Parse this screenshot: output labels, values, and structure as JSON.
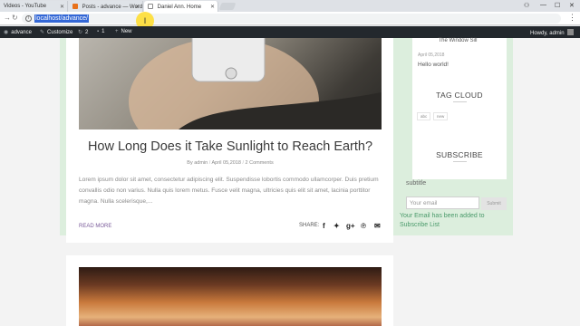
{
  "browser": {
    "tabs": [
      {
        "title": "Videos - YouTube",
        "favicon": "youtube-icon",
        "active": false
      },
      {
        "title": "Posts - advance — Word",
        "favicon": "wordpress-icon",
        "active": false
      },
      {
        "title": "Daniel Ann. Home",
        "favicon": "page-icon",
        "active": true
      }
    ],
    "url": "localhost/advance/",
    "cursor_label": "I"
  },
  "adminbar": {
    "site_name": "advance",
    "customize": "Customize",
    "updates_count": "2",
    "comments_count": "1",
    "new_label": "New",
    "howdy": "Howdy, admin"
  },
  "post": {
    "title": "How Long Does it Take Sunlight to Reach Earth?",
    "meta_by": "By",
    "author": "admin",
    "date": "April 05,2018",
    "comments": "2 Comments",
    "excerpt": "Lorem ipsum dolor sit amet, consectetur adipiscing elit. Suspendisse lobortis commodo ullamcorper. Duis pretium convallis odio non varius. Nulla quis lorem metus. Fusce velit magna, ultricies quis elit sit amet, lacinia porttitor magna. Nulla scelerisque,...",
    "read_more": "READ MORE",
    "share_label": "SHARE:"
  },
  "sidebar": {
    "recent_title": "The Window Sill",
    "recent_date": "April 05,2018",
    "recent_post": "Hello world!",
    "tag_cloud_title": "TAG CLOUD",
    "tags": [
      "abc",
      "new"
    ],
    "subscribe_title": "SUBSCRIBE",
    "subtitle": "subtitle",
    "email_placeholder": "Your email",
    "submit_label": "Submit",
    "added_message": "Your Email has been added to Subscribe List"
  },
  "colors": {
    "accent_purple": "#7a5b9a",
    "success_green": "#4a9a6a",
    "band_green": "#dceedd"
  }
}
